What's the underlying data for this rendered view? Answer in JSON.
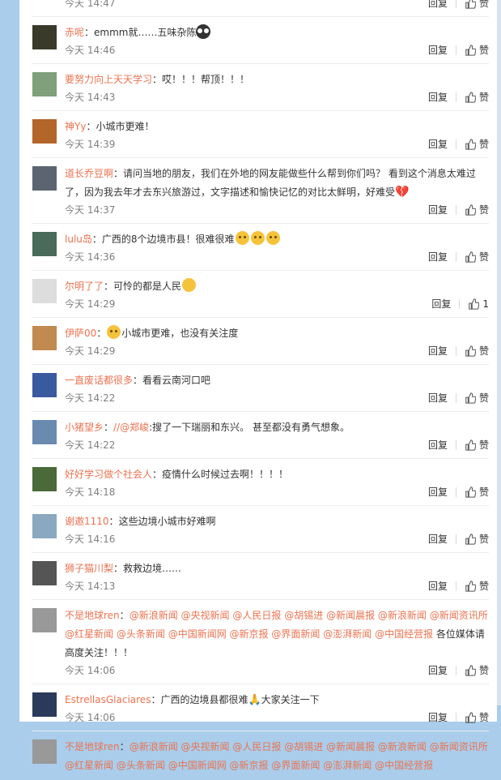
{
  "comments": [
    {
      "user": "",
      "text": "",
      "time": "今天 14:47",
      "reply": "回复",
      "like": "赞",
      "avatar_color": "#8aa"
    },
    {
      "user": "赤呢",
      "text": "emmm就……五味杂陈",
      "emoji": "owl",
      "time": "今天 14:46",
      "reply": "回复",
      "like": "赞",
      "avatar_color": "#3a3a2a"
    },
    {
      "user": "要努力向上天天学习",
      "text": "哎！！！帮顶！！！",
      "time": "今天 14:43",
      "reply": "回复",
      "like": "赞",
      "avatar_color": "#7fa07a"
    },
    {
      "user": "神Yy",
      "text": "小城市更难！",
      "time": "今天 14:39",
      "reply": "回复",
      "like": "赞",
      "avatar_color": "#b3652a"
    },
    {
      "user": "道长乔豆啊",
      "text": "请问当地的朋友，我们在外地的网友能做些什么帮到你们吗？ 看到这个消息太难过了，因为我去年才去东兴旅游过，文字描述和愉快记忆的对比太鲜明，好难受",
      "emoji": "heart",
      "time": "今天 14:37",
      "reply": "回复",
      "like": "赞",
      "avatar_color": "#5b6470"
    },
    {
      "user": "lulu岛",
      "text": "广西的8个边境市县！很难很难",
      "emoji": "sad3",
      "time": "今天 14:36",
      "reply": "回复",
      "like": "赞",
      "avatar_color": "#4a6a5a"
    },
    {
      "user": "尔明了了",
      "text": "可怜的都是人民",
      "emoji": "smile",
      "time": "今天 14:29",
      "reply": "回复",
      "like": "1",
      "avatar_color": "#ddd"
    },
    {
      "user": "伊萨00",
      "text": "小城市更难，也没有关注度",
      "emoji_before": "sad",
      "time": "今天 14:29",
      "reply": "回复",
      "like": "赞",
      "avatar_color": "#c08a50"
    },
    {
      "user": "一直废话都很多",
      "text": "看看云南河口吧",
      "time": "今天 14:22",
      "reply": "回复",
      "like": "赞",
      "avatar_color": "#3a5aa0"
    },
    {
      "user": "小猪望乡",
      "mention": "//@郑峻",
      "text": ":搜了一下瑞丽和东兴。 甚至都没有勇气想象。",
      "time": "今天 14:22",
      "reply": "回复",
      "like": "赞",
      "avatar_color": "#6a8ab0"
    },
    {
      "user": "好好学习做个社会人",
      "text": "疫情什么时候过去啊！！！！",
      "time": "今天 14:18",
      "reply": "回复",
      "like": "赞",
      "avatar_color": "#4a6a3a"
    },
    {
      "user": "谢邀1110",
      "text": "这些边境小城市好难啊",
      "time": "今天 14:16",
      "reply": "回复",
      "like": "赞",
      "avatar_color": "#8aa8c0"
    },
    {
      "user": "狮子猫川梨",
      "text": "救救边境……",
      "time": "今天 14:13",
      "reply": "回复",
      "like": "赞",
      "avatar_color": "#555"
    },
    {
      "user": "不是地球ren",
      "mentions": [
        "@新浪新闻",
        "@央视新闻",
        "@人民日报",
        "@胡锡进",
        "@新闻晨报",
        "@新浪新闻",
        "@新闻资讯所",
        "@红星新闻",
        "@头条新闻",
        "@中国新闻网",
        "@新京报",
        "@界面新闻",
        "@澎湃新闻",
        "@中国经营报"
      ],
      "text_after": "各位媒体请高度关注！！！",
      "time": "今天 14:06",
      "reply": "回复",
      "like": "赞",
      "avatar_color": "#999"
    },
    {
      "user": "EstrellasGlaciares",
      "text": "广西的边境县都很难",
      "text_after": "大家关注一下",
      "emoji": "pray",
      "time": "今天 14:06",
      "reply": "回复",
      "like": "赞",
      "avatar_color": "#2a3a5a"
    },
    {
      "user": "不是地球ren",
      "mentions": [
        "@新浪新闻",
        "@央视新闻",
        "@人民日报",
        "@胡锡进",
        "@新闻晨报",
        "@新浪新闻",
        "@新闻资讯所",
        "@红星新闻",
        "@头条新闻",
        "@中国新闻网",
        "@新京报",
        "@界面新闻",
        "@澎湃新闻",
        "@中国经营报"
      ],
      "text_after": "",
      "time": "",
      "reply": "",
      "like": "",
      "avatar_color": "#999"
    }
  ]
}
